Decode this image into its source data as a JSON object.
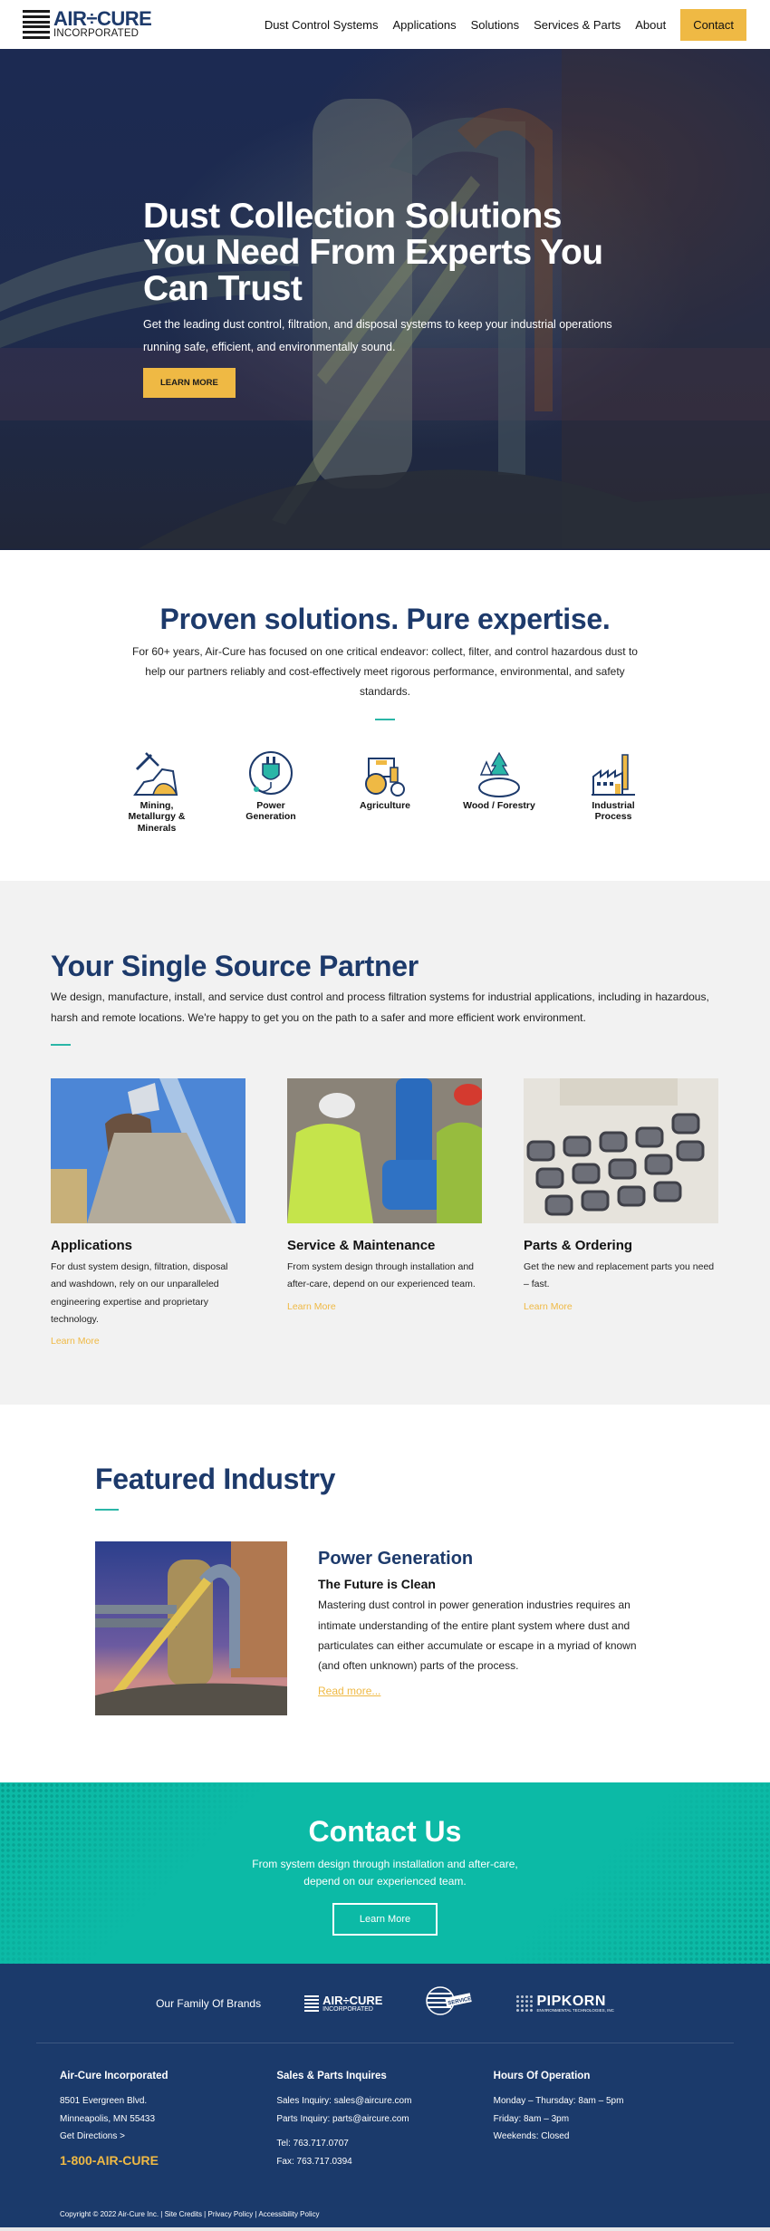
{
  "header": {
    "logo": {
      "main": "AIR÷CURE",
      "sub": "INCORPORATED"
    },
    "nav": [
      {
        "label": "Dust Control Systems"
      },
      {
        "label": "Applications"
      },
      {
        "label": "Solutions"
      },
      {
        "label": "Services & Parts"
      },
      {
        "label": "About"
      }
    ],
    "contact_label": "Contact"
  },
  "hero": {
    "title": "Dust Collection Solutions You Need From Experts You Can Trust",
    "subtitle": "Get the leading dust control, filtration, and disposal systems to keep your industrial operations running safe, efficient, and environmentally sound.",
    "button": "LEARN MORE"
  },
  "proven": {
    "title": "Proven solutions. Pure expertise.",
    "body": "For 60+ years, Air-Cure has focused on one critical endeavor: collect, filter, and control hazardous dust to help our partners reliably and cost-effectively meet rigorous performance, environmental, and safety standards.",
    "industries": [
      {
        "label": "Mining, Metallurgy & Minerals",
        "icon": "mining-icon"
      },
      {
        "label": "Power Generation",
        "icon": "power-plug-icon"
      },
      {
        "label": "Agriculture",
        "icon": "tractor-icon"
      },
      {
        "label": "Wood / Forestry",
        "icon": "trees-icon"
      },
      {
        "label": "Industrial Process",
        "icon": "factory-icon"
      }
    ]
  },
  "single_source": {
    "title": "Your Single Source Partner",
    "body": "We design, manufacture, install, and service dust control and process filtration systems for industrial applications, including in hazardous, harsh and remote locations. We're happy to get you on the path to a safer and more efficient work environment.",
    "cards": [
      {
        "title": "Applications",
        "body": "For dust system design, filtration, disposal and washdown, rely on our unparalleled engineering expertise and proprietary technology.",
        "link": "Learn More"
      },
      {
        "title": "Service & Maintenance",
        "body": "From system design through installation and after-care, depend on our experienced team.",
        "link": "Learn More"
      },
      {
        "title": "Parts & Ordering",
        "body": "Get the new and replacement parts you need – fast.",
        "link": "Learn More"
      }
    ]
  },
  "featured": {
    "title": "Featured Industry",
    "industry": "Power Generation",
    "tagline": "The Future is Clean",
    "body": "Mastering dust control in power generation industries requires an intimate understanding of the entire plant system where dust and particulates can either accumulate or escape in a myriad of known (and often unknown) parts of the process.",
    "link": "Read more..."
  },
  "contact": {
    "title": "Contact Us",
    "body_line1": "From system design through installation and after-care,",
    "body_line2": "depend on our experienced team.",
    "button": "Learn More"
  },
  "footer": {
    "brands_label": "Our Family Of Brands",
    "brands": [
      {
        "main": "AIR÷CURE",
        "sub": "INCORPORATED"
      },
      {
        "main": "AIR-CURE SERVICE"
      },
      {
        "main": "PIPKORN",
        "sub": "ENVIRONMENTAL TECHNOLOGIES, INC"
      }
    ],
    "col1": {
      "title": "Air-Cure Incorporated",
      "lines": [
        "8501 Evergreen Blvd.",
        "Minneapolis, MN 55433",
        "Get Directions >"
      ],
      "phone": "1-800-AIR-CURE"
    },
    "col2": {
      "title": "Sales & Parts Inquires",
      "lines": [
        "Sales Inquiry: sales@aircure.com",
        "Parts Inquiry: parts@aircure.com"
      ],
      "lines2": [
        "Tel: 763.717.0707",
        "Fax: 763.717.0394"
      ]
    },
    "col3": {
      "title": "Hours Of Operation",
      "lines": [
        "Monday – Thursday: 8am – 5pm",
        "Friday: 8am – 3pm",
        "Weekends: Closed"
      ]
    },
    "copyright": "Copyright © 2022 Air-Cure Inc.",
    "links": [
      "Site Credits",
      "Privacy Policy",
      "Accessibility Policy"
    ],
    "separator": " | "
  },
  "colors": {
    "brand_navy": "#1d3a6b",
    "accent_yellow": "#efb944",
    "accent_teal": "#0cbaa6",
    "footer_bg": "#1b3a6b"
  }
}
